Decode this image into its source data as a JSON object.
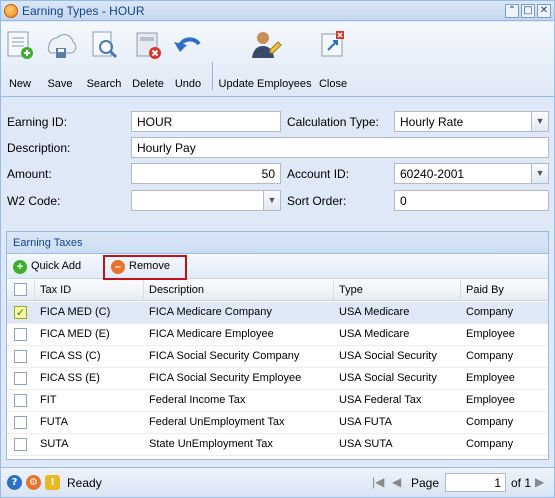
{
  "window": {
    "title": "Earning Types - HOUR"
  },
  "toolbar": {
    "new": "New",
    "save": "Save",
    "search": "Search",
    "delete": "Delete",
    "undo": "Undo",
    "update_employees": "Update Employees",
    "close": "Close"
  },
  "form": {
    "earning_id_label": "Earning ID:",
    "earning_id_value": "HOUR",
    "calculation_type_label": "Calculation Type:",
    "calculation_type_value": "Hourly Rate",
    "description_label": "Description:",
    "description_value": "Hourly Pay",
    "amount_label": "Amount:",
    "amount_value": "50",
    "account_id_label": "Account ID:",
    "account_id_value": "60240-2001",
    "w2_code_label": "W2 Code:",
    "w2_code_value": "",
    "sort_order_label": "Sort Order:",
    "sort_order_value": "0"
  },
  "taxes": {
    "panel_title": "Earning Taxes",
    "quick_add": "Quick Add",
    "remove": "Remove",
    "columns": {
      "tax_id": "Tax ID",
      "description": "Description",
      "type": "Type",
      "paid_by": "Paid By"
    },
    "rows": [
      {
        "tax_id": "FICA MED (C)",
        "description": "FICA Medicare Company",
        "type": "USA Medicare",
        "paid_by": "Company",
        "checked": true
      },
      {
        "tax_id": "FICA MED (E)",
        "description": "FICA Medicare Employee",
        "type": "USA Medicare",
        "paid_by": "Employee",
        "checked": false
      },
      {
        "tax_id": "FICA SS (C)",
        "description": "FICA Social Security Company",
        "type": "USA Social Security",
        "paid_by": "Company",
        "checked": false
      },
      {
        "tax_id": "FICA SS (E)",
        "description": "FICA Social Security Employee",
        "type": "USA Social Security",
        "paid_by": "Employee",
        "checked": false
      },
      {
        "tax_id": "FIT",
        "description": "Federal Income Tax",
        "type": "USA Federal Tax",
        "paid_by": "Employee",
        "checked": false
      },
      {
        "tax_id": "FUTA",
        "description": "Federal UnEmployment Tax",
        "type": "USA FUTA",
        "paid_by": "Company",
        "checked": false
      },
      {
        "tax_id": "SUTA",
        "description": "State UnEmployment Tax",
        "type": "USA SUTA",
        "paid_by": "Company",
        "checked": false
      }
    ]
  },
  "status": {
    "text": "Ready",
    "page_label": "Page",
    "page_value": "1",
    "of_label": "of 1"
  },
  "colors": {
    "accent": "#15428b",
    "highlight_border": "#c0121b",
    "selected_row": "#dfe8f6"
  }
}
